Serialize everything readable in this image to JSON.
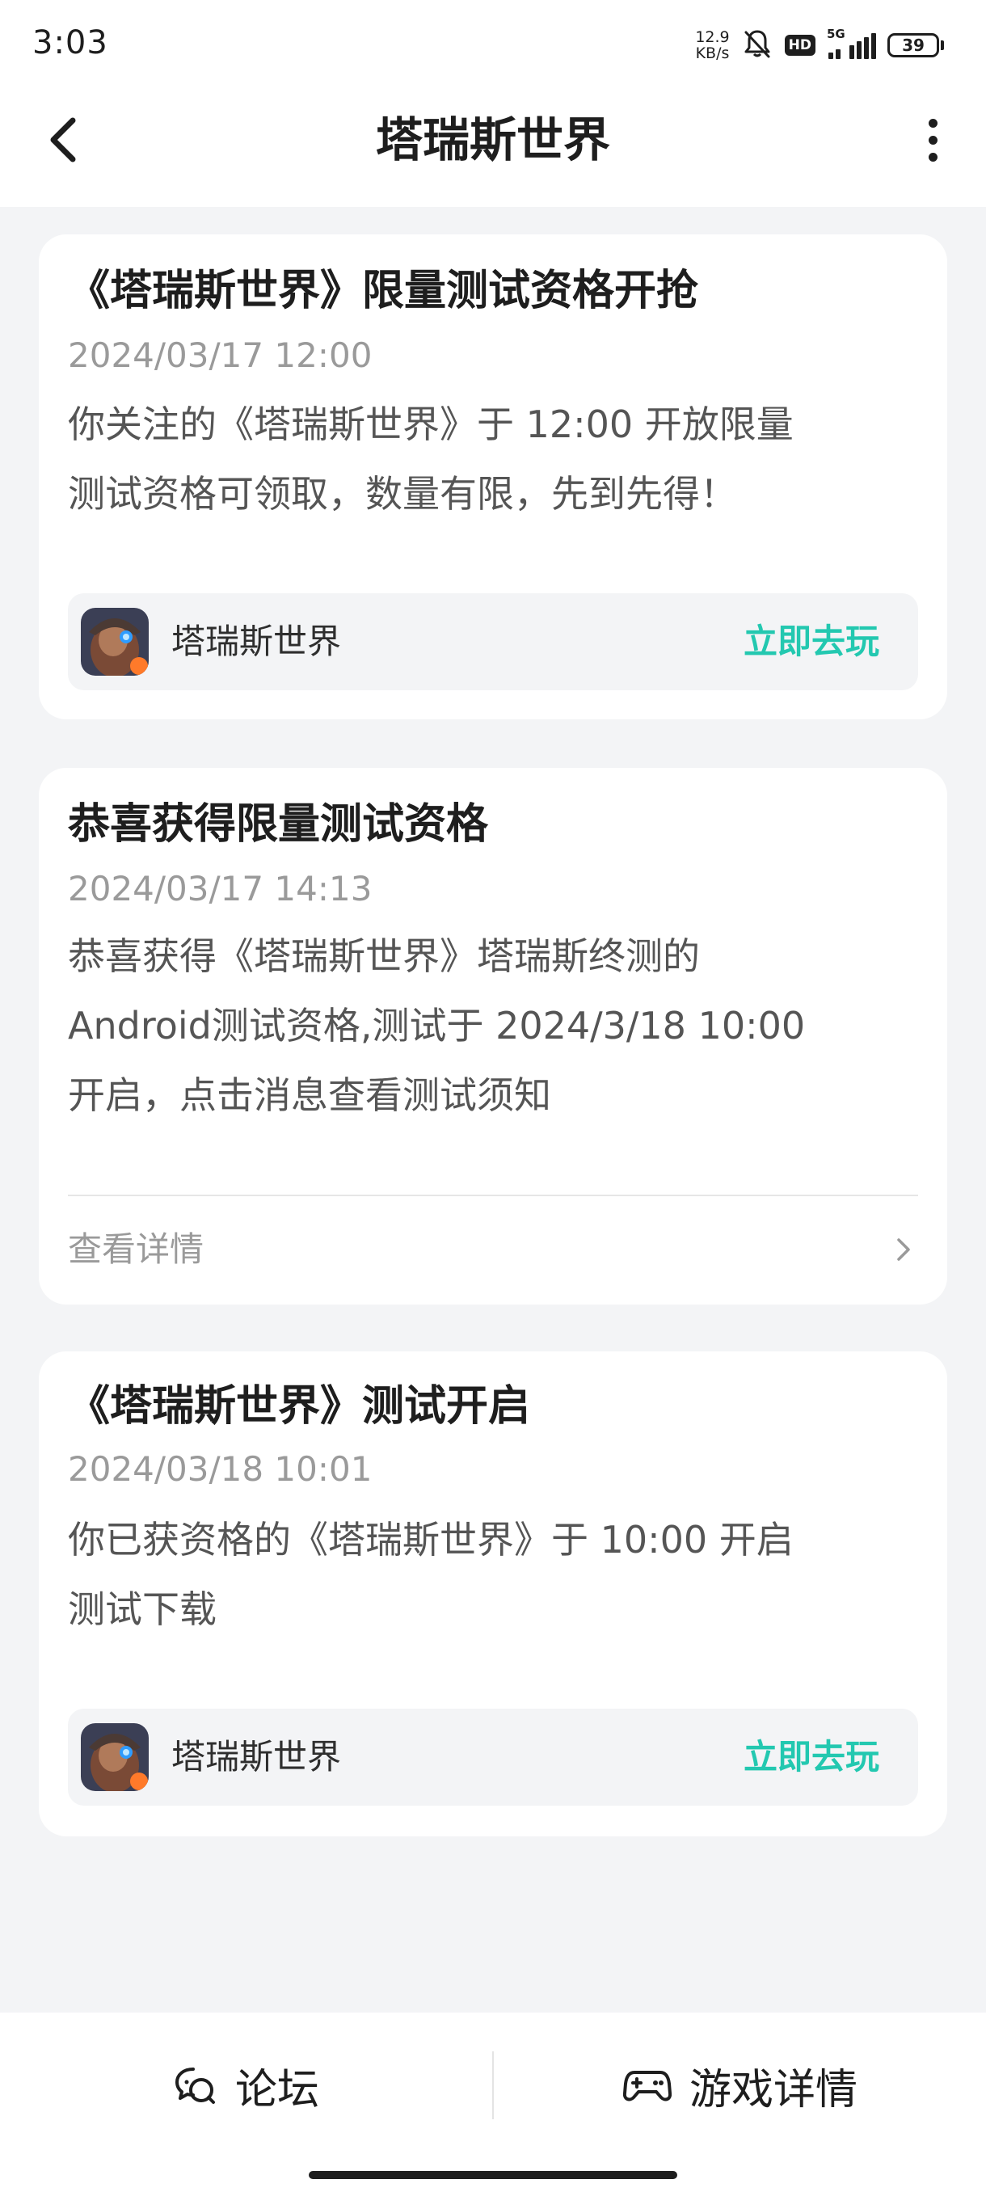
{
  "status_bar": {
    "time": "3:03",
    "net_speed_value": "12.9",
    "net_speed_unit": "KB/s",
    "hd_badge": "HD",
    "network_type": "5G",
    "battery": "39",
    "icons": [
      "mute-bell-icon",
      "hd-icon",
      "signal-icon",
      "battery-icon"
    ]
  },
  "header": {
    "title": "塔瑞斯世界",
    "back_icon": "back-arrow-icon",
    "more_icon": "more-vertical-icon"
  },
  "messages": [
    {
      "title": "《塔瑞斯世界》限量测试资格开抢",
      "date": "2024/03/17 12:00",
      "body_lines": [
        "你关注的《塔瑞斯世界》于 12:00 开放限量",
        "测试资格可领取，数量有限，先到先得！"
      ],
      "game_name": "塔瑞斯世界",
      "action_label": "立即去玩"
    },
    {
      "title": "恭喜获得限量测试资格",
      "date": "2024/03/17 14:13",
      "body_lines": [
        "恭喜获得《塔瑞斯世界》塔瑞斯终测的",
        "Android测试资格,测试于 2024/3/18 10:00",
        "开启，点击消息查看测试须知"
      ],
      "detail_label": "查看详情"
    },
    {
      "title": "《塔瑞斯世界》测试开启",
      "date": "2024/03/18 10:01",
      "body_lines": [
        "你已获资格的《塔瑞斯世界》于 10:00 开启",
        "测试下载"
      ],
      "game_name": "塔瑞斯世界",
      "action_label": "立即去玩"
    }
  ],
  "bottom_bar": {
    "forum_label": "论坛",
    "forum_icon": "forum-chat-icon",
    "game_detail_label": "游戏详情",
    "game_detail_icon": "gamepad-icon"
  },
  "colors": {
    "accent": "#23c8b0",
    "background": "#f3f4f6",
    "card": "#ffffff",
    "muted_text": "#9a9a9a"
  }
}
